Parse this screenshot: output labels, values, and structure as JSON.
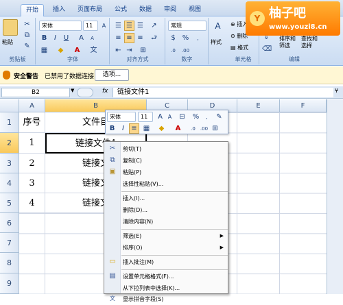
{
  "ribbon": {
    "tabs": [
      "开始",
      "插入",
      "页面布局",
      "公式",
      "数据",
      "审阅",
      "视图"
    ],
    "groups": {
      "clipboard": "剪贴板",
      "font": "字体",
      "alignment": "对齐方式",
      "number": "数字",
      "cells": "单元格",
      "editing": "编辑"
    },
    "paste_label": "粘贴",
    "font_name": "宋体",
    "font_size": "11",
    "number_format": "常规",
    "styles_label": "样式",
    "insert_label": "插入",
    "delete_label": "删除",
    "format_label": "格式",
    "sort_filter_label": "排序和\n筛选",
    "find_select_label": "查找和\n选择"
  },
  "logo": {
    "title": "柚子吧",
    "url": "www.youzi8.cn",
    "badge": "Y"
  },
  "security_bar": {
    "title": "安全警告",
    "message": "已禁用了数据连接",
    "options_button": "选项..."
  },
  "formula_bar": {
    "name_box": "B2",
    "fx": "fx",
    "content": "链接文件1"
  },
  "grid": {
    "columns": [
      "A",
      "B",
      "C",
      "D",
      "E",
      "F"
    ],
    "rows": [
      "1",
      "2",
      "3",
      "4",
      "5",
      "6",
      "7",
      "8",
      "9"
    ],
    "header_row": {
      "a": "序号",
      "b": "文件目"
    },
    "data_rows": [
      {
        "a": "1",
        "b": "链接文件1"
      },
      {
        "a": "2",
        "b": "链接文"
      },
      {
        "a": "3",
        "b": "链接文"
      },
      {
        "a": "4",
        "b": "链接文"
      }
    ]
  },
  "mini_toolbar": {
    "font": "宋体",
    "size": "11"
  },
  "context_menu": {
    "items": [
      {
        "label": "剪切(T)",
        "icon": "scissors-icon"
      },
      {
        "label": "复制(C)",
        "icon": "copy-icon"
      },
      {
        "label": "粘贴(P)",
        "icon": "paste-icon"
      },
      {
        "label": "选择性粘贴(V)...",
        "icon": ""
      },
      {
        "label": "插入(I)...",
        "icon": ""
      },
      {
        "label": "删除(D)...",
        "icon": ""
      },
      {
        "label": "清除内容(N)",
        "icon": ""
      },
      {
        "label": "筛选(E)",
        "icon": "",
        "submenu": true
      },
      {
        "label": "排序(O)",
        "icon": "",
        "submenu": true
      },
      {
        "label": "插入批注(M)",
        "icon": "comment-icon"
      },
      {
        "label": "设置单元格格式(F)...",
        "icon": "format-cells-icon"
      },
      {
        "label": "从下拉列表中选择(K)...",
        "icon": ""
      },
      {
        "label": "显示拼音字段(S)",
        "icon": "pinyin-icon"
      }
    ]
  },
  "colors": {
    "selected_header": "#f9c95b",
    "ribbon_bg": "#cadcf2",
    "logo_bg": "#ff7a00"
  }
}
